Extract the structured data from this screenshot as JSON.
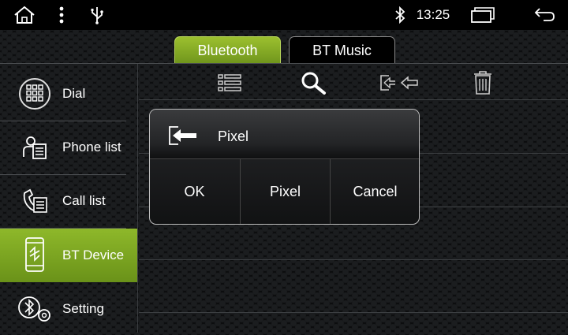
{
  "status_bar": {
    "time": "13:25",
    "icons": [
      "home-icon",
      "overflow-menu-icon",
      "usb-icon",
      "bluetooth-icon",
      "recent-apps-icon",
      "back-icon"
    ]
  },
  "tabs": [
    {
      "label": "Bluetooth",
      "active": true
    },
    {
      "label": "BT Music",
      "active": false
    }
  ],
  "sidebar": {
    "items": [
      {
        "label": "Dial",
        "icon": "dialpad-icon"
      },
      {
        "label": "Phone list",
        "icon": "contacts-icon"
      },
      {
        "label": "Call list",
        "icon": "call-log-icon"
      },
      {
        "label": "BT Device",
        "icon": "bt-device-icon",
        "active": true
      },
      {
        "label": "Setting",
        "icon": "bt-settings-icon"
      }
    ]
  },
  "toolbar": {
    "icons": [
      "list-icon",
      "search-icon",
      "connect-icon",
      "trash-icon"
    ]
  },
  "dialog": {
    "title": "Pixel",
    "icon": "incoming-connection-icon",
    "buttons": [
      "OK",
      "Pixel",
      "Cancel"
    ]
  },
  "colors": {
    "accent_green": "#7fa823",
    "background": "#0b0c0d"
  }
}
